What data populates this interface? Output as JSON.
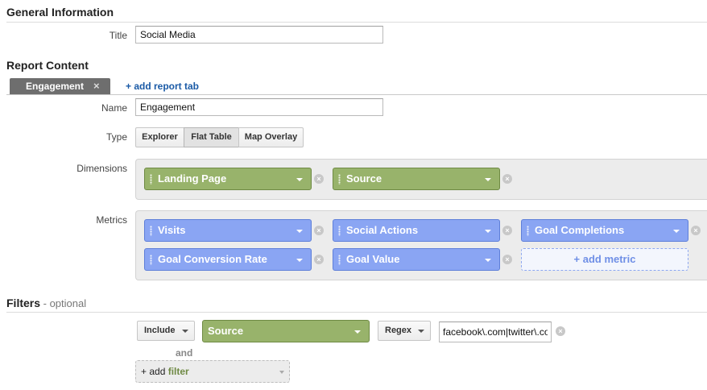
{
  "general": {
    "heading": "General Information",
    "title_label": "Title",
    "title_value": "Social Media"
  },
  "report_content": {
    "heading": "Report Content",
    "active_tab": "Engagement",
    "close_glyph": "×",
    "add_tab_link": "+ add report tab",
    "name_label": "Name",
    "name_value": "Engagement",
    "type_label": "Type",
    "type_options": [
      "Explorer",
      "Flat Table",
      "Map Overlay"
    ],
    "type_selected": "Flat Table",
    "dimensions_label": "Dimensions",
    "dimensions": [
      "Landing Page",
      "Source"
    ],
    "metrics_label": "Metrics",
    "metrics": [
      "Visits",
      "Social Actions",
      "Goal Completions",
      "Goal Conversion Rate",
      "Goal Value"
    ],
    "add_metric": "+ add metric",
    "remove_glyph": "×"
  },
  "filters": {
    "heading": "Filters",
    "optional": " - optional",
    "include": "Include",
    "dimension": "Source",
    "match_type": "Regex",
    "expression": "facebook\\.com|twitter\\.co",
    "and_label": "and",
    "add_filter_prefix": "+ add",
    "add_filter_word": "filter"
  },
  "colors": {
    "dimension_chip": "#98b36b",
    "metric_chip": "#8aa5f3",
    "link": "#1a5aa6"
  },
  "icons": {
    "drag_handle": "grip-icon",
    "dropdown": "chevron-down-icon",
    "remove": "close-icon"
  }
}
